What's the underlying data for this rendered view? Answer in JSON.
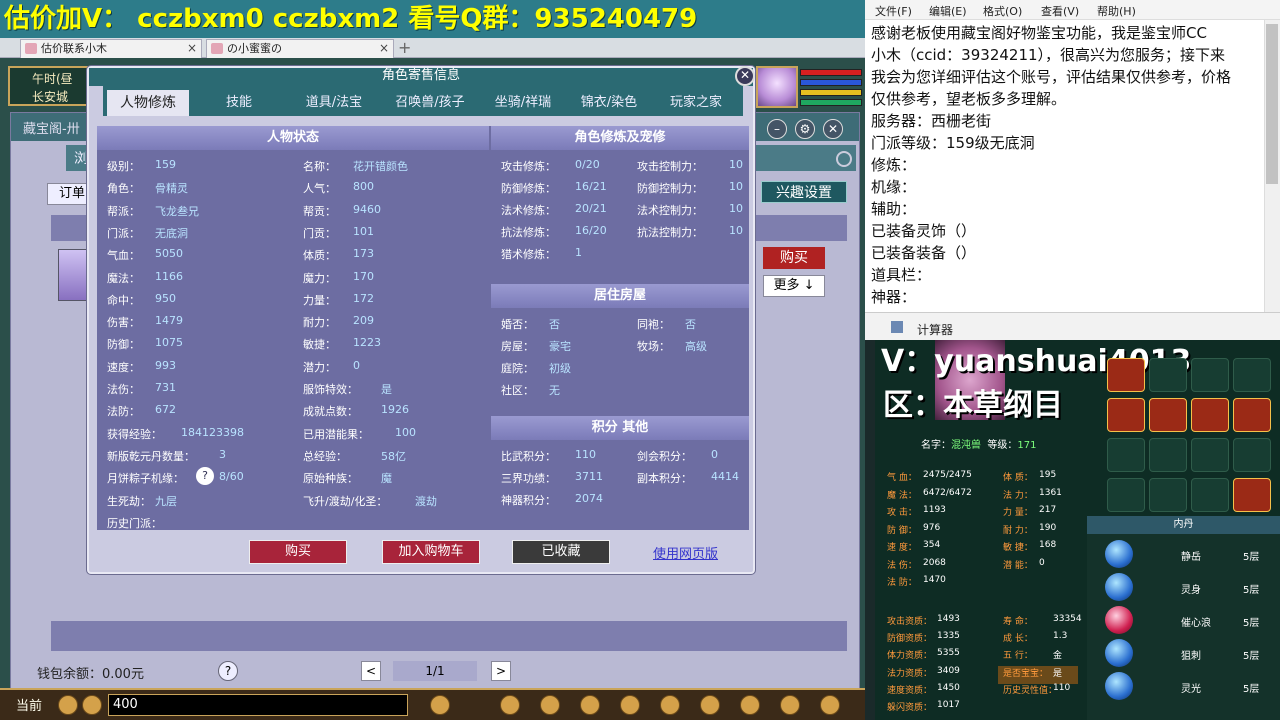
{
  "banner": {
    "text": "估价加V：  cczbxm0   cczbxm2   看号Q群：935240479"
  },
  "browser_tabs": [
    {
      "label": "估价联系小木"
    },
    {
      "label": "の小蜜蜜の"
    }
  ],
  "hud": {
    "time": "午时(昼",
    "location": "长安城"
  },
  "store": {
    "title": "藏宝阁-卅",
    "browse": "浏",
    "order_btn": "订单",
    "interest_btn": "兴趣设置",
    "buy_btn": "购买",
    "more_btn": "更多 ↓",
    "wallet": "钱包余额：0.00元",
    "help": "?",
    "pager": {
      "prev": "<",
      "value": "1/1",
      "next": ">"
    }
  },
  "dialog": {
    "title": "角色寄售信息",
    "close": "✕",
    "tabs": [
      "人物修炼",
      "技能",
      "道具/法宝",
      "召唤兽/孩子",
      "坐骑/祥瑞",
      "锦衣/染色",
      "玩家之家"
    ],
    "status": {
      "header": "人物状态",
      "left": [
        {
          "k": "级别：",
          "v": "159"
        },
        {
          "k": "角色：",
          "v": "骨精灵"
        },
        {
          "k": "帮派：",
          "v": "飞龙叁兄"
        },
        {
          "k": "门派：",
          "v": "无底洞"
        },
        {
          "k": "气血：",
          "v": "5050"
        },
        {
          "k": "魔法：",
          "v": "1166"
        },
        {
          "k": "命中：",
          "v": "950"
        },
        {
          "k": "伤害：",
          "v": "1479"
        },
        {
          "k": "防御：",
          "v": "1075"
        },
        {
          "k": "速度：",
          "v": "993"
        },
        {
          "k": "法伤：",
          "v": "731"
        },
        {
          "k": "法防：",
          "v": "672"
        },
        {
          "k": "获得经验：",
          "v": "184123398"
        },
        {
          "k": "新版乾元丹数量：",
          "v": "3"
        },
        {
          "k": "月饼粽子机缘：",
          "v": "8/60"
        },
        {
          "k": "生死劫：",
          "v": "九层"
        },
        {
          "k": "历史门派：",
          "v": ""
        }
      ],
      "right": [
        {
          "k": "名称：",
          "v": "花开错颜色"
        },
        {
          "k": "人气：",
          "v": "800"
        },
        {
          "k": "帮贡：",
          "v": "9460"
        },
        {
          "k": "门贡：",
          "v": "101"
        },
        {
          "k": "体质：",
          "v": "173"
        },
        {
          "k": "魔力：",
          "v": "170"
        },
        {
          "k": "力量：",
          "v": "172"
        },
        {
          "k": "耐力：",
          "v": "209"
        },
        {
          "k": "敏捷：",
          "v": "1223"
        },
        {
          "k": "潜力：",
          "v": "0"
        },
        {
          "k": "服饰特效：",
          "v": "是"
        },
        {
          "k": "成就点数：",
          "v": "1926"
        },
        {
          "k": "已用潜能果：",
          "v": "100"
        },
        {
          "k": "总经验：",
          "v": "58亿"
        },
        {
          "k": "原始种族：",
          "v": "魔"
        },
        {
          "k": "飞升/渡劫/化圣：",
          "v": "渡劫"
        }
      ]
    },
    "cultivation": {
      "header": "角色修炼及宠修",
      "left": [
        {
          "k": "攻击修炼：",
          "v": "0/20"
        },
        {
          "k": "防御修炼：",
          "v": "16/21"
        },
        {
          "k": "法术修炼：",
          "v": "20/21"
        },
        {
          "k": "抗法修炼：",
          "v": "16/20"
        },
        {
          "k": "猎术修炼：",
          "v": "1"
        }
      ],
      "right": [
        {
          "k": "攻击控制力：",
          "v": "10"
        },
        {
          "k": "防御控制力：",
          "v": "10"
        },
        {
          "k": "法术控制力：",
          "v": "10"
        },
        {
          "k": "抗法控制力：",
          "v": "10"
        }
      ]
    },
    "house": {
      "header": "居住房屋",
      "left": [
        {
          "k": "婚否：",
          "v": "否"
        },
        {
          "k": "房屋：",
          "v": "豪宅"
        },
        {
          "k": "庭院：",
          "v": "初级"
        },
        {
          "k": "社区：",
          "v": "无"
        }
      ],
      "right": [
        {
          "k": "同袍：",
          "v": "否"
        },
        {
          "k": "牧场：",
          "v": "高级"
        }
      ]
    },
    "points": {
      "header": "积分 其他",
      "left": [
        {
          "k": "比武积分：",
          "v": "110"
        },
        {
          "k": "三界功绩：",
          "v": "3711"
        },
        {
          "k": "神器积分：",
          "v": "2074"
        }
      ],
      "right": [
        {
          "k": "剑会积分：",
          "v": "0"
        },
        {
          "k": "副本积分：",
          "v": "4414"
        }
      ]
    },
    "help_icon": "?",
    "buttons": {
      "buy": "购买",
      "cart": "加入购物车",
      "collected": "已收藏",
      "web": "使用网页版"
    }
  },
  "gamebar": {
    "current": "当前",
    "input": "400"
  },
  "notepad": {
    "menu": [
      "文件(F)",
      "编辑(E)",
      "格式(O)",
      "查看(V)",
      "帮助(H)"
    ],
    "text": "感谢老板使用藏宝阁好物鉴宝功能，我是鉴宝师CC\n小木（ccid：39324211），很高兴为您服务；接下来\n我会为您详细评估这个账号，评估结果仅供参考，价格\n仅供参考，望老板多多理解。\n服务器：西栅老街\n门派等级：159级无底洞\n修炼：\n机缘：\n辅助：\n已装备灵饰（）\n已装备装备（）\n道具栏：\n神器："
  },
  "calc": {
    "label": "计算器"
  },
  "pet": {
    "v_line": "V：yuanshuai4013",
    "zone_line": "区：本草纲目",
    "name_k": "名字：",
    "name_v": "混沌兽",
    "level_k": "等级：",
    "level_v": "171",
    "stats_left": [
      {
        "k": "气    血：",
        "v": "2475/2475"
      },
      {
        "k": "魔    法：",
        "v": "6472/6472"
      },
      {
        "k": "攻    击：",
        "v": "1193"
      },
      {
        "k": "防    御：",
        "v": "976"
      },
      {
        "k": "速    度：",
        "v": "354"
      },
      {
        "k": "法    伤：",
        "v": "2068"
      },
      {
        "k": "法    防：",
        "v": "1470"
      }
    ],
    "stats_right": [
      {
        "k": "体    质：",
        "v": "195"
      },
      {
        "k": "法    力：",
        "v": "1361"
      },
      {
        "k": "力    量：",
        "v": "217"
      },
      {
        "k": "耐    力：",
        "v": "190"
      },
      {
        "k": "敏    捷：",
        "v": "168"
      },
      {
        "k": "潜    能：",
        "v": "0"
      }
    ],
    "apt_left": [
      {
        "k": "攻击资质：",
        "v": "1493"
      },
      {
        "k": "防御资质：",
        "v": "1335"
      },
      {
        "k": "体力资质：",
        "v": "5355"
      },
      {
        "k": "法力资质：",
        "v": "3409"
      },
      {
        "k": "速度资质：",
        "v": "1450"
      },
      {
        "k": "躲闪资质：",
        "v": "1017"
      }
    ],
    "apt_right": [
      {
        "k": "寿    命：",
        "v": "33354"
      },
      {
        "k": "成    长：",
        "v": "1.3"
      },
      {
        "k": "五    行：",
        "v": "金"
      },
      {
        "k": "是否宝宝：",
        "v": "是"
      },
      {
        "k": "历史灵性值：",
        "v": "110"
      }
    ],
    "neidan_header": "内丹",
    "neidan": [
      {
        "name": "静岳",
        "level": "5层"
      },
      {
        "name": "灵身",
        "level": "5层"
      },
      {
        "name": "催心浪",
        "level": "5层"
      },
      {
        "name": "狙刺",
        "level": "5层"
      },
      {
        "name": "灵光",
        "level": "5层"
      }
    ]
  },
  "colors": {
    "accent": "#2b6a73",
    "buy_red": "#a8243a",
    "panel": "#6d6da2"
  }
}
